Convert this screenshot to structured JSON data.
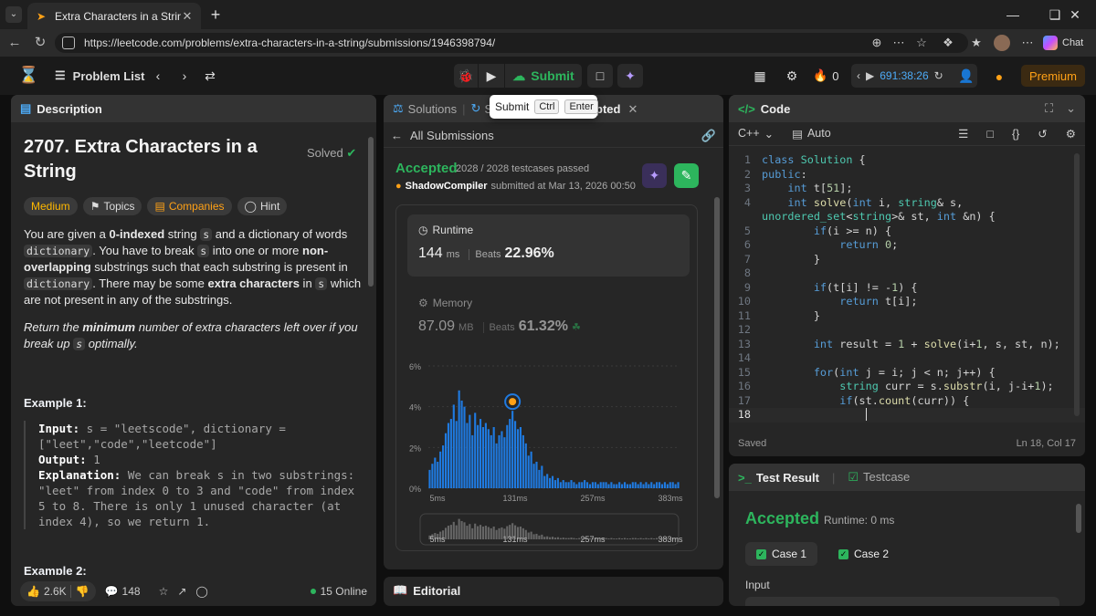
{
  "browser": {
    "tab_title": "Extra Characters in a String - LeetC",
    "url": "https://leetcode.com/problems/extra-characters-in-a-string/submissions/1946398794/",
    "chat_label": "Chat"
  },
  "header": {
    "problem_list": "Problem List",
    "submit": "Submit",
    "fire_count": "0",
    "timer": "691:38:26",
    "premium": "Premium"
  },
  "tooltip": {
    "label": "Submit",
    "key1": "Ctrl",
    "key2": "Enter"
  },
  "description": {
    "tab": "Description",
    "title": "2707. Extra Characters in a String",
    "solved": "Solved",
    "tags": {
      "difficulty": "Medium",
      "topics": "Topics",
      "companies": "Companies",
      "hint": "Hint"
    },
    "p1": {
      "a": "You are given a ",
      "b": "0-indexed",
      "c": " string ",
      "s1": "s",
      "d": " and a dictionary of words ",
      "dict1": "dictionary",
      "e": ". You have to break ",
      "s2": "s",
      "f": " into one or more ",
      "g": "non-overlapping",
      "h": " substrings such that each substring is present in ",
      "dict2": "dictionary",
      "i": ". There may be some ",
      "j": "extra characters",
      "k": " in ",
      "s3": "s",
      "l": " which are not present in any of the substrings."
    },
    "p2": {
      "a": "Return the ",
      "b": "minimum",
      "c": " number of extra characters left over if you break up ",
      "s": "s",
      "d": " optimally."
    },
    "example1_heading": "Example 1:",
    "example1": {
      "input_label": "Input:",
      "input": " s = \"leetscode\", dictionary = [\"leet\",\"code\",\"leetcode\"]",
      "output_label": "Output:",
      "output": " 1",
      "expl_label": "Explanation:",
      "expl": " We can break s in two substrings: \"leet\" from index 0 to 3 and \"code\" from index 5 to 8. There is only 1 unused character (at index 4), so we return 1."
    },
    "example2_heading": "Example 2:",
    "footer": {
      "likes": "2.6K",
      "comments": "148",
      "online": "15 Online"
    }
  },
  "submissions": {
    "tab_solutions": "Solutions",
    "tab_submissions_partial": "S",
    "tab_accepted_partial": "pted",
    "all_submissions": "All Submissions",
    "status": "Accepted",
    "testcases": "2028 / 2028 testcases passed",
    "user": "ShadowCompiler",
    "submitted_at": "submitted at Mar 13, 2026 00:50",
    "runtime_label": "Runtime",
    "runtime_value": "144",
    "runtime_unit": "ms",
    "beats_label": "Beats",
    "runtime_beats": "22.96%",
    "memory_label": "Memory",
    "memory_value": "87.09",
    "memory_unit": "MB",
    "memory_beats": "61.32%",
    "editorial": "Editorial"
  },
  "chart_data": {
    "type": "bar",
    "yticks": [
      "6%",
      "4%",
      "2%",
      "0%"
    ],
    "ylim": [
      0,
      6
    ],
    "xticks": [
      "5ms",
      "131ms",
      "257ms",
      "383ms"
    ],
    "values": [
      0.9,
      1.2,
      1.5,
      1.3,
      1.8,
      2.1,
      2.7,
      3.2,
      3.4,
      4.1,
      3.3,
      4.8,
      4.3,
      4.0,
      3.2,
      3.6,
      2.6,
      3.7,
      3.1,
      3.4,
      3.0,
      3.2,
      2.9,
      2.6,
      3.0,
      2.2,
      2.6,
      2.8,
      2.5,
      3.1,
      3.4,
      3.8,
      3.3,
      2.9,
      3.0,
      2.6,
      2.2,
      1.6,
      1.8,
      1.2,
      1.3,
      0.9,
      1.1,
      0.6,
      0.7,
      0.5,
      0.6,
      0.4,
      0.5,
      0.3,
      0.4,
      0.3,
      0.3,
      0.4,
      0.3,
      0.2,
      0.3,
      0.3,
      0.4,
      0.3,
      0.2,
      0.3,
      0.3,
      0.2,
      0.3,
      0.3,
      0.3,
      0.2,
      0.3,
      0.2,
      0.2,
      0.3,
      0.2,
      0.3,
      0.2,
      0.2,
      0.3,
      0.3,
      0.2,
      0.3,
      0.2,
      0.3,
      0.2,
      0.3,
      0.2,
      0.3,
      0.3,
      0.2,
      0.3,
      0.2,
      0.3,
      0.3,
      0.2,
      0.3
    ],
    "highlight_index": 31,
    "color": "#1f7ae0"
  },
  "code": {
    "tab": "Code",
    "language": "C++",
    "mode": "Auto",
    "lines": [
      [
        [
          "kw",
          "class "
        ],
        [
          "ty",
          "Solution"
        ],
        [
          "tx",
          " {"
        ]
      ],
      [
        [
          "kw",
          "public"
        ],
        [
          "tx",
          ":"
        ]
      ],
      [
        [
          "tx",
          "    "
        ],
        [
          "kw",
          "int "
        ],
        [
          "tx",
          "t["
        ],
        [
          "nm",
          "51"
        ],
        [
          "tx",
          "];"
        ]
      ],
      [
        [
          "tx",
          "    "
        ],
        [
          "kw",
          "int "
        ],
        [
          "fn",
          "solve"
        ],
        [
          "tx",
          "("
        ],
        [
          "kw",
          "int "
        ],
        [
          "tx",
          "i, "
        ],
        [
          "ty",
          "string"
        ],
        [
          "tx",
          "& s,"
        ]
      ],
      [
        [
          "ty",
          "unordered_set"
        ],
        [
          "tx",
          "<"
        ],
        [
          "ty",
          "string"
        ],
        [
          "tx",
          ">& st, "
        ],
        [
          "kw",
          "int "
        ],
        [
          "tx",
          "&n) {"
        ]
      ],
      [
        [
          "tx",
          "        "
        ],
        [
          "kw",
          "if"
        ],
        [
          "tx",
          "(i >= n) {"
        ]
      ],
      [
        [
          "tx",
          "            "
        ],
        [
          "kw",
          "return "
        ],
        [
          "nm",
          "0"
        ],
        [
          "tx",
          ";"
        ]
      ],
      [
        [
          "tx",
          "        }"
        ]
      ],
      [
        [
          "tx",
          ""
        ]
      ],
      [
        [
          "tx",
          "        "
        ],
        [
          "kw",
          "if"
        ],
        [
          "tx",
          "(t[i] != -"
        ],
        [
          "nm",
          "1"
        ],
        [
          "tx",
          ") {"
        ]
      ],
      [
        [
          "tx",
          "            "
        ],
        [
          "kw",
          "return "
        ],
        [
          "tx",
          "t[i];"
        ]
      ],
      [
        [
          "tx",
          "        }"
        ]
      ],
      [
        [
          "tx",
          ""
        ]
      ],
      [
        [
          "tx",
          "        "
        ],
        [
          "kw",
          "int "
        ],
        [
          "tx",
          "result = "
        ],
        [
          "nm",
          "1"
        ],
        [
          "tx",
          " + "
        ],
        [
          "fn",
          "solve"
        ],
        [
          "tx",
          "(i+"
        ],
        [
          "nm",
          "1"
        ],
        [
          "tx",
          ", s, st, n);"
        ]
      ],
      [
        [
          "tx",
          ""
        ]
      ],
      [
        [
          "tx",
          "        "
        ],
        [
          "kw",
          "for"
        ],
        [
          "tx",
          "("
        ],
        [
          "kw",
          "int "
        ],
        [
          "tx",
          "j = i; j < n; j++) {"
        ]
      ],
      [
        [
          "tx",
          "            "
        ],
        [
          "ty",
          "string "
        ],
        [
          "tx",
          "curr = s."
        ],
        [
          "fn",
          "substr"
        ],
        [
          "tx",
          "(i, j-i+"
        ],
        [
          "nm",
          "1"
        ],
        [
          "tx",
          ");"
        ]
      ],
      [
        [
          "tx",
          "            "
        ],
        [
          "kw",
          "if"
        ],
        [
          "tx",
          "(st."
        ],
        [
          "fn",
          "count"
        ],
        [
          "tx",
          "(curr)) {"
        ]
      ],
      [
        [
          "tx",
          "                "
        ]
      ]
    ],
    "line_numbers": [
      "1",
      "2",
      "3",
      "4",
      "",
      "5",
      "6",
      "7",
      "8",
      "9",
      "10",
      "11",
      "12",
      "13",
      "14",
      "15",
      "16",
      "17",
      "18"
    ],
    "saved": "Saved",
    "cursor": "Ln 18, Col 17"
  },
  "test": {
    "tab_result": "Test Result",
    "tab_testcase": "Testcase",
    "status": "Accepted",
    "runtime": "Runtime: 0 ms",
    "case1": "Case 1",
    "case2": "Case 2",
    "input_label": "Input"
  }
}
